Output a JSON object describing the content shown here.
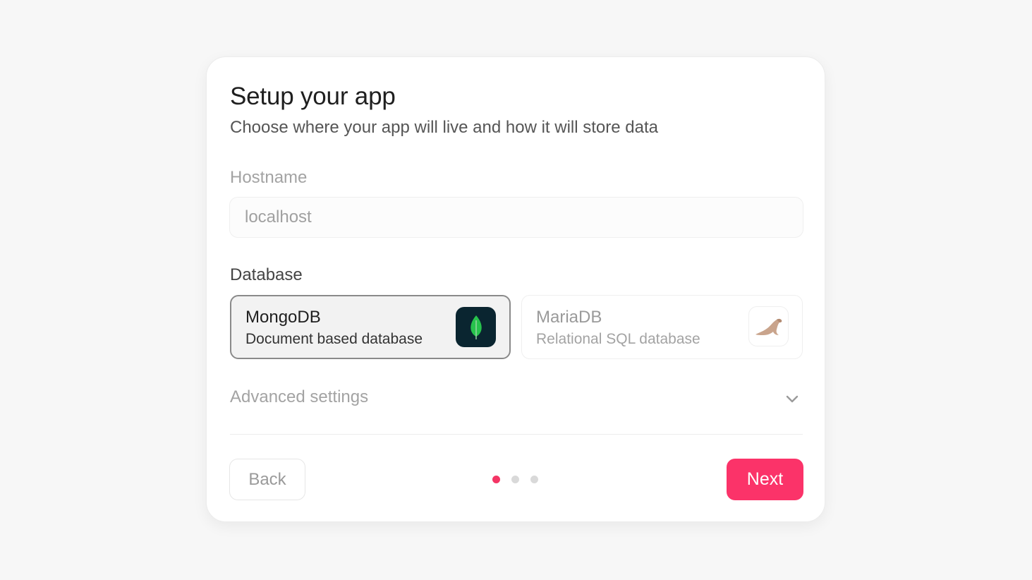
{
  "header": {
    "title": "Setup your app",
    "subtitle": "Choose where your app will live and how it will store data"
  },
  "hostname": {
    "label": "Hostname",
    "placeholder": "localhost"
  },
  "database": {
    "label": "Database",
    "options": [
      {
        "name": "MongoDB",
        "description": "Document based database",
        "icon": "mongodb-leaf-icon",
        "selected": true
      },
      {
        "name": "MariaDB",
        "description": "Relational SQL database",
        "icon": "mariadb-seal-icon",
        "selected": false
      }
    ]
  },
  "advanced": {
    "label": "Advanced settings",
    "icon": "chevron-down-icon",
    "expanded": false
  },
  "footer": {
    "back_label": "Back",
    "next_label": "Next",
    "steps_total": 3,
    "current_step": 1
  },
  "colors": {
    "accent": "#fb3369",
    "mongo_bg": "#0a2530",
    "mongo_leaf": "#27c24c"
  }
}
